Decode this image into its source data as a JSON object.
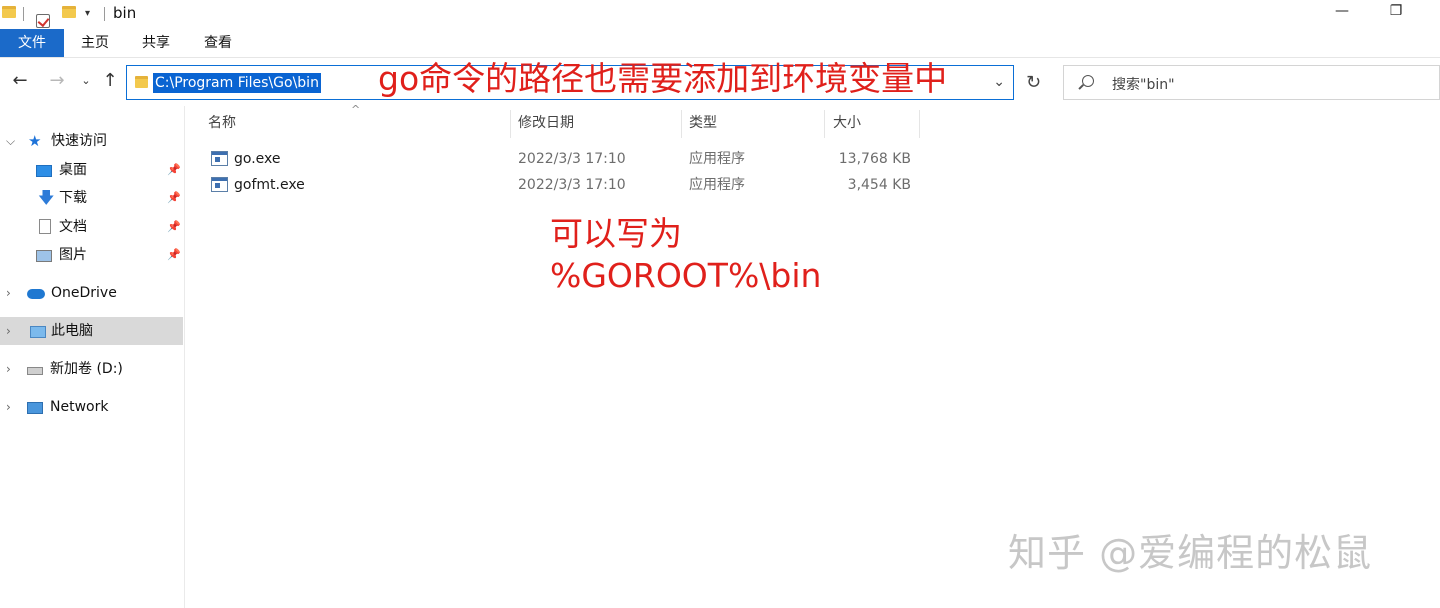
{
  "window": {
    "title": "bin",
    "minimize_icon": "—",
    "maximize_icon": "❐"
  },
  "ribbon": {
    "tabs": [
      "文件",
      "主页",
      "共享",
      "查看"
    ]
  },
  "address": {
    "path": "C:\\Program Files\\Go\\bin",
    "search_placeholder": "搜索\"bin\""
  },
  "annotations": {
    "note1": "go命令的路径也需要添加到环境变量中",
    "note2_line1": "可以写为",
    "note2_line2": "%GOROOT%\\bin"
  },
  "sidebar": {
    "items": [
      {
        "label": "快速访问",
        "icon": "star-icon"
      },
      {
        "label": "桌面",
        "icon": "desktop-icon"
      },
      {
        "label": "下载",
        "icon": "download-icon"
      },
      {
        "label": "文档",
        "icon": "document-icon"
      },
      {
        "label": "图片",
        "icon": "pictures-icon"
      },
      {
        "label": "OneDrive",
        "icon": "cloud-icon"
      },
      {
        "label": "此电脑",
        "icon": "computer-icon"
      },
      {
        "label": "新加卷 (D:)",
        "icon": "drive-icon"
      },
      {
        "label": "Network",
        "icon": "network-icon"
      }
    ],
    "selected": "此电脑"
  },
  "file_list": {
    "columns": [
      "名称",
      "修改日期",
      "类型",
      "大小"
    ],
    "rows": [
      {
        "name": "go.exe",
        "modified": "2022/3/3 17:10",
        "type": "应用程序",
        "size": "13,768 KB"
      },
      {
        "name": "gofmt.exe",
        "modified": "2022/3/3 17:10",
        "type": "应用程序",
        "size": "3,454 KB"
      }
    ]
  },
  "watermark": "知乎 @爱编程的松鼠",
  "colors": {
    "accent": "#1b6ac9",
    "annotation": "#e0201b",
    "selection": "#0a64d2"
  }
}
